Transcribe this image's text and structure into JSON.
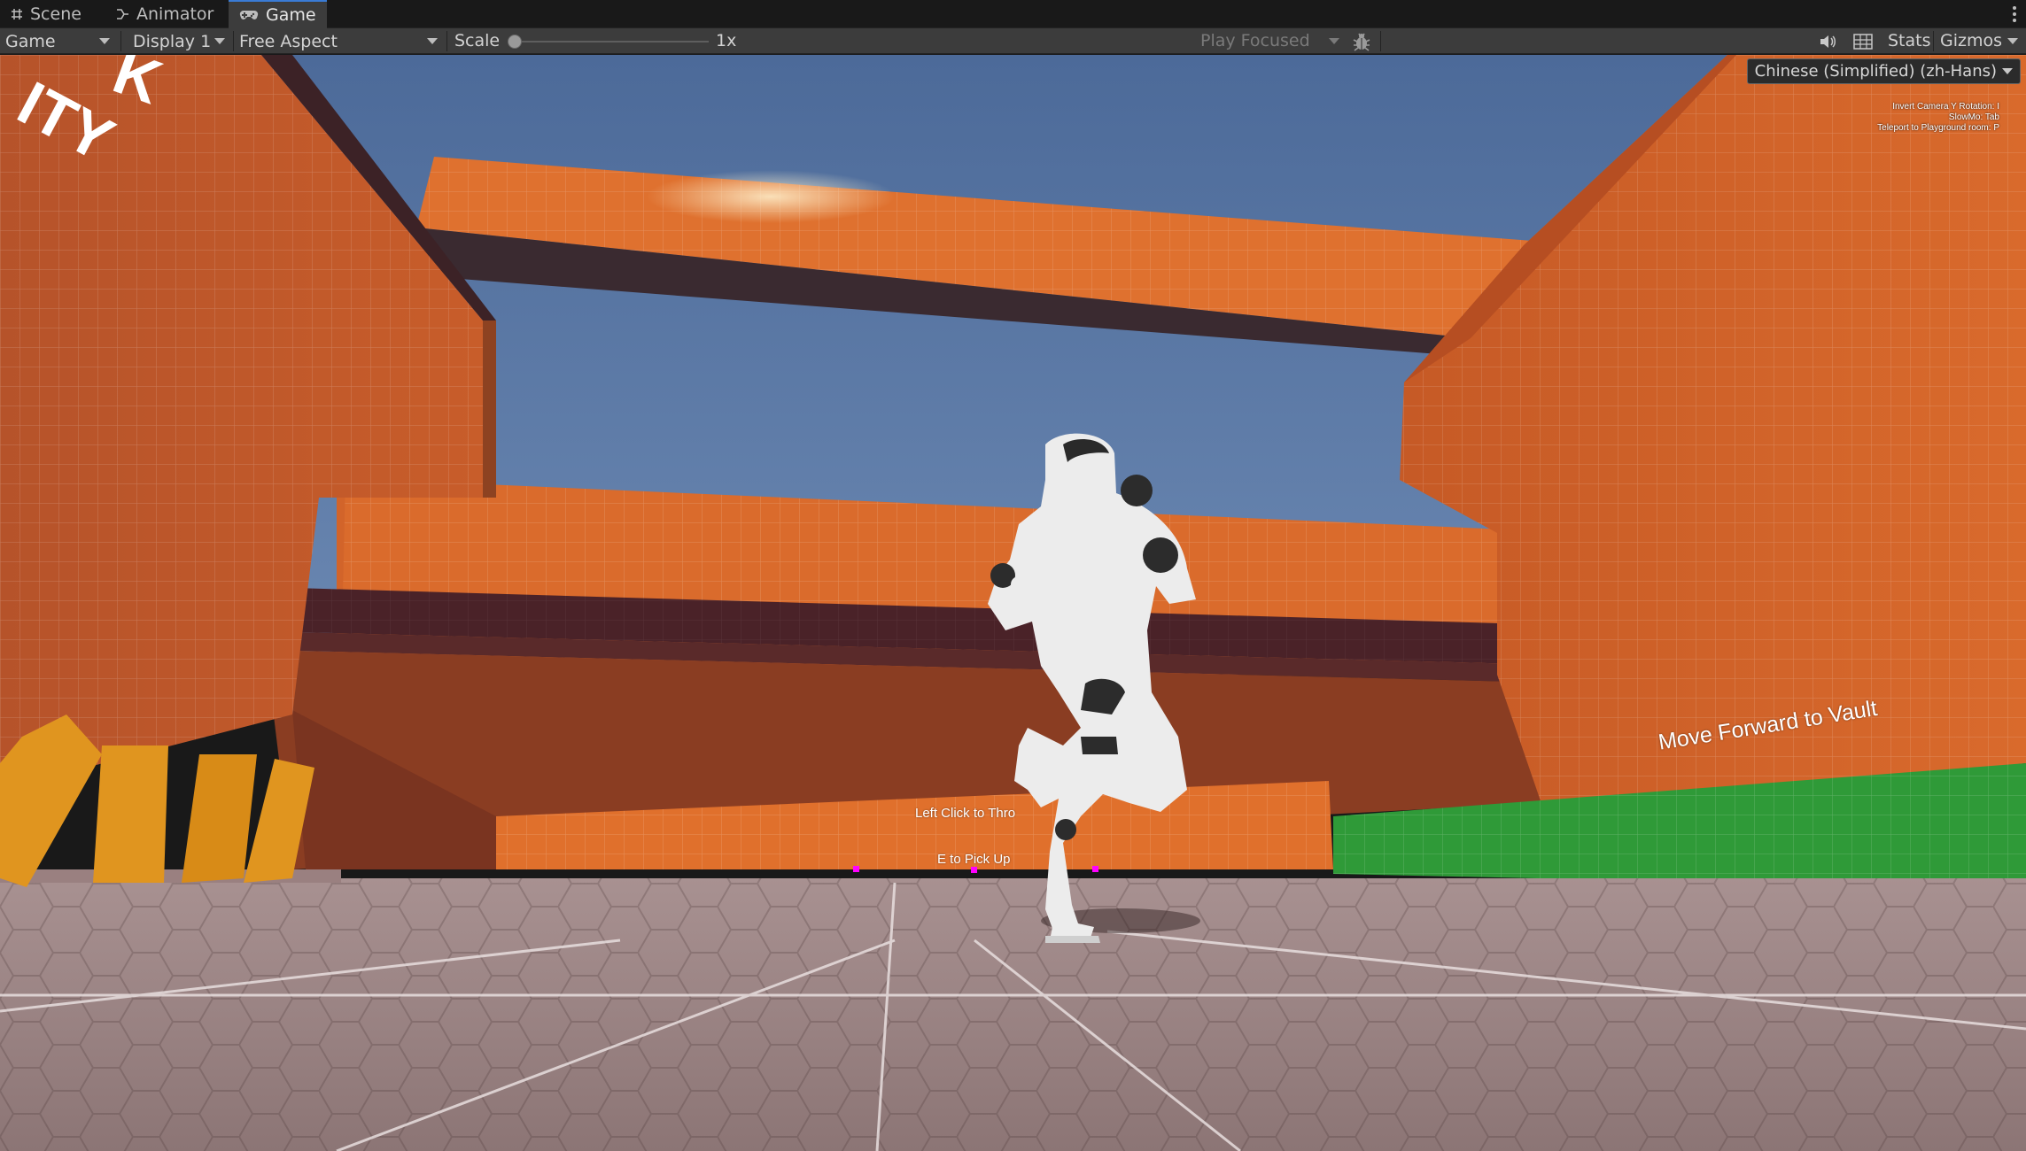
{
  "tabs": [
    {
      "label": "Scene",
      "icon": "grid-icon",
      "active": false
    },
    {
      "label": "Animator",
      "icon": "animator-icon",
      "active": false
    },
    {
      "label": "Game",
      "icon": "gamepad-icon",
      "active": true
    }
  ],
  "toolbar": {
    "view_mode": "Game",
    "display": "Display 1",
    "aspect": "Free Aspect",
    "scale_label": "Scale",
    "scale_value": "1x",
    "play_mode": "Play Focused",
    "stats_label": "Stats",
    "gizmos_label": "Gizmos",
    "icons": [
      "bug-icon",
      "speaker-icon",
      "grid-layout-icon"
    ]
  },
  "game": {
    "locale": "Chinese (Simplified) (zh-Hans)",
    "help_lines": [
      "Invert Camera Y Rotation: I",
      "SlowMo: Tab",
      "Teleport to Playground room: P"
    ],
    "vault_hint": "Move Forward to Vault",
    "throw_hint": "Left Click to Thro",
    "pickup_hint": "E to Pick Up",
    "logo_fragment": [
      "K",
      "ITY"
    ],
    "colors": {
      "wall_orange": "#d9692a",
      "wall_dark": "#a9441c",
      "sky": "#5b7aa8",
      "floor": "#9b8585",
      "ledge": "#4a2228",
      "green_platform": "#2f9a38",
      "yellow_posts": "#e0951f",
      "marker": "#ff00ff"
    }
  }
}
